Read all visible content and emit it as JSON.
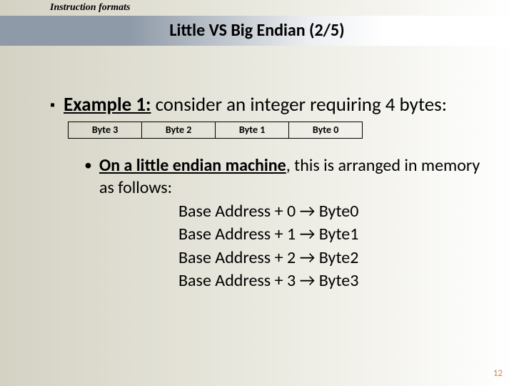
{
  "header": {
    "section": "Instruction formats"
  },
  "title": "Little VS Big Endian (2/5)",
  "main_bullet": {
    "label_bold_underline": "Example 1:",
    "text_rest": " consider an integer requiring 4 bytes:"
  },
  "byte_cells": [
    "Byte 3",
    "Byte 2",
    "Byte 1",
    "Byte 0"
  ],
  "sub_bullet": {
    "prefix_bold_underline": "On a little endian machine",
    "suffix": ", this is arranged in memory as follows:"
  },
  "mappings": [
    "Base Address + 0 → Byte0",
    "Base Address + 1 → Byte1",
    "Base Address + 2 → Byte2",
    "Base Address + 3 → Byte3"
  ],
  "page_number": "12"
}
